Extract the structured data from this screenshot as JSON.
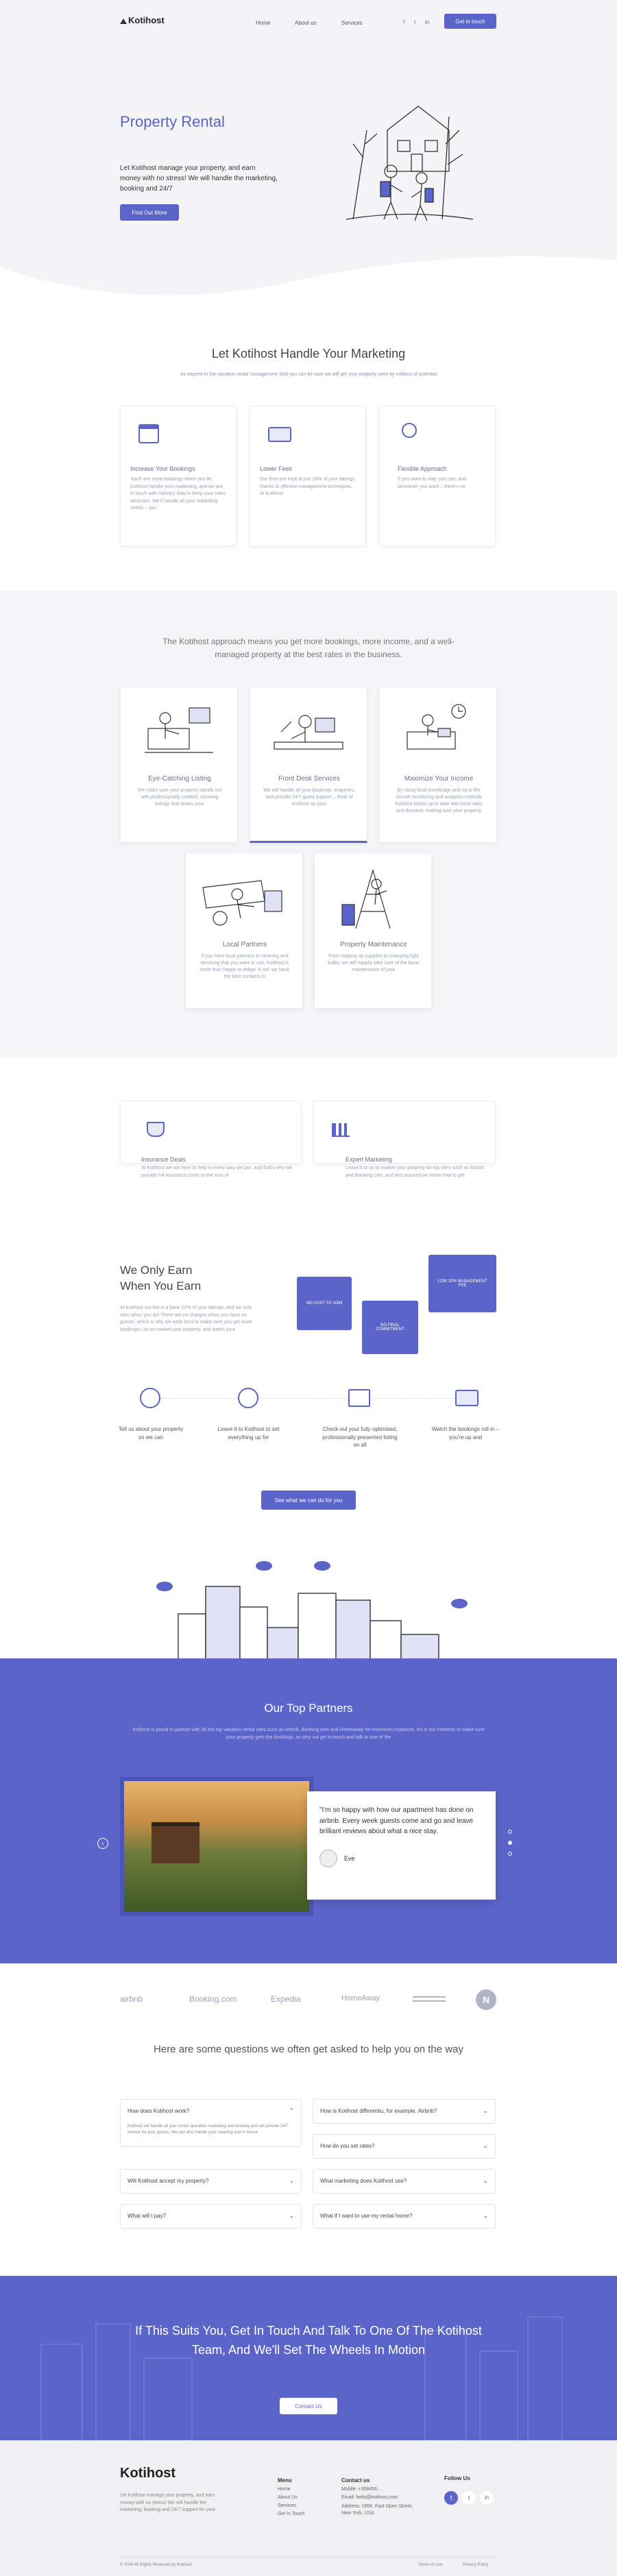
{
  "header": {
    "logo": "Kotihost",
    "nav": [
      "Home",
      "About us",
      "Services"
    ],
    "cta": "Get in touch"
  },
  "hero": {
    "title": "Property Rental",
    "text": "Let Kotihost manage your property, and earn money with no stress! We will handle the marketing, booking and 24/7",
    "button": "Find Out More"
  },
  "marketing": {
    "title": "Let Kotihost Handle Your Marketing",
    "subtitle": "As experts in the vacation rental management field you can be sure we will get your property seen by millions of potential",
    "cards": [
      {
        "title": "Increase Your Bookings",
        "text": "You'll see more bookings when you let Kotihost handle your marketing, and we are in touch with industry data to keep your rates attractive. We'll handle all your marketing needs – you"
      },
      {
        "title": "Lower Fees",
        "text": "Our fees are kept at just 20% of your takings thanks to efficient management techniques. At Kotihost"
      },
      {
        "title": "Flexible Approach",
        "text": "If you want to stay, you can, and whenever you want – there's no"
      }
    ]
  },
  "approach": {
    "title": "The Kotihost approach means you get more bookings, more income, and a well-managed property at the best rates in the business.",
    "cards": [
      {
        "title": "Eye-Catching Listing",
        "text": "We make sure your property stands out with professionally created, stunning listings that draws your"
      },
      {
        "title": "Front Desk Services",
        "text": "We will handle all your bookings, enquiries, and provide 24/7 guest support – think of Kotihost as your"
      },
      {
        "title": "Maximize Your Income",
        "text": "By using local knowledge and up to the minute monitoring and analysis methods Kotihost keeps up to date with local rates and demand, making sure your property"
      },
      {
        "title": "Local Partners",
        "text": "If you have local partners in cleaning and servicing that you want to use, Kotihost is more than happy to oblige. If not, we have the best contacts in"
      },
      {
        "title": "Property Maintenance",
        "text": "From topping up supplies to changing light bulbs, we will happily take care of the basic maintenance of your"
      }
    ]
  },
  "extras": [
    {
      "title": "Insurance Deals",
      "text": "At Kotihost we are here to help in every way we can, and that's why we provide full insurance cover to the sum of"
    },
    {
      "title": "Expert Marketing",
      "text": "Leave it to us to market your property on top sites such as Airbnb and Booking.com, and rest assured we know how to get"
    }
  ],
  "earn": {
    "title_line1": "We Only Earn",
    "title_line2": "When You Earn",
    "text": "At Kotihost our fee is a bank 20% of your takings, and we only earn when you do! There are no charges when you have no guests, which is why we work hard to make sure you get more bookings! Let us market your property, and watch your",
    "boxes": [
      "NO COST TO JOIN",
      "NO FINAL COMMITMENT",
      "LOW 20% MANAGEMENT FEE"
    ],
    "steps": [
      "Tell us about your property so we can",
      "Leave it to Kotihost to set everything up for",
      "Check out your fully optimised, professionally presented listing on all",
      "Watch the bookings roll in – you're up and"
    ],
    "button": "See what we can do for you"
  },
  "partners": {
    "title": "Our Top Partners",
    "text": "Kotihost is proud to partner with all the top vacation rental sites such as Airbnb, Booking.com and Homeaway for maximum exposure. It's in our interests to make sure your property gets the bookings, so why not get in touch and talk to one of the",
    "quote": "\"I'm so happy with how our apartment has done on airbnb. Every week guests come and go and leave brilliant reviews about what a nice stay.",
    "author": "Eve"
  },
  "logos": [
    "airbnb",
    "Booking.com",
    "Expedia",
    "HomeAway",
    "",
    "N"
  ],
  "faq": {
    "title": "Here are some questions we often get asked to help you on the way",
    "items": [
      {
        "q": "How does Kotihost work?",
        "a": "Kotihost will handle all your rental operation marketing and booking and will provide 24/7 service for your guests. We can also handle your cleaning and in house"
      },
      {
        "q": "How is Kotihost differentiu, for example, Airbnb?"
      },
      {
        "q": "How do you set rates?"
      },
      {
        "q": "Will Kotihost accept my property?"
      },
      {
        "q": "What marketing does Kotihost use?"
      },
      {
        "q": "What will I pay?"
      },
      {
        "q": "What if I want to use my rental home?"
      }
    ]
  },
  "cta": {
    "title": "If This Suits You, Get In Touch And Talk To One Of The Kotihost Team, And We'll Set The Wheels In Motion",
    "button": "Contact Us"
  },
  "footer": {
    "logo": "Kotihost",
    "about": "Let Kotihost manage your property, and earn money with no stress! We will handle the marketing, booking and 24/7 support for your",
    "menu_title": "Menu",
    "menu": [
      "Home",
      "About Us",
      "Services",
      "Get In Touch"
    ],
    "contact_title": "Contact us",
    "contact": [
      "Mobile: +358456...",
      "Email: hello@kotihost.com",
      "Address: 1956, Fast Open Street, New York, USA"
    ],
    "follow_title": "Follow Us",
    "copyright": "© 2024 All Rights Reserved by Kotihost",
    "terms": "Terms of Use",
    "privacy": "Privacy Policy"
  },
  "colors": {
    "accent": "#5b64c9",
    "text": "#333333"
  }
}
